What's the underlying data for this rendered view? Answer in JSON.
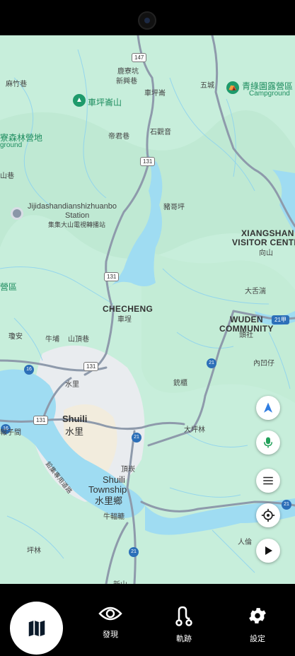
{
  "map": {
    "route_shields": [
      {
        "id": "r147",
        "text": "147"
      },
      {
        "id": "r131a",
        "text": "131"
      },
      {
        "id": "r131b",
        "text": "131"
      },
      {
        "id": "r131c",
        "text": "131"
      },
      {
        "id": "r131d",
        "text": "131"
      },
      {
        "id": "r16a",
        "text": "16"
      },
      {
        "id": "r16b",
        "text": "16"
      },
      {
        "id": "r21a",
        "text": "21"
      },
      {
        "id": "r21b",
        "text": "21"
      },
      {
        "id": "r21c",
        "text": "21"
      },
      {
        "id": "r21d",
        "text": "21"
      },
      {
        "id": "r21e",
        "text": "21甲"
      }
    ],
    "places": {
      "mazhu": "麻竹巷",
      "luliaokeng": "鹿寮坑",
      "xinxingxiang": "新興巷",
      "checheng_shan": "車坪崙山",
      "chepinglun": "車坪崙",
      "wucheng": "五城",
      "dijunxiang": "帝君巷",
      "shiguyin": "石觀音",
      "zhugeping": "豬哥坪",
      "liaosenlin": "寮森林營地",
      "ground": "ground",
      "shanxiang": "山巷",
      "xiangshan_en": "XIANGSHAN",
      "visitor_center_en": "VISITOR CENTER",
      "xiangshan_zh": "向山",
      "ying": "營區",
      "dashewan": "大舌湍",
      "checheng_en": "CHECHENG",
      "checheng_zh": "車埕",
      "wuden_en": "WUDEN",
      "community_en": "COMMUNITY",
      "wuden_zh": "頭社",
      "guian": "瓊安",
      "niuku": "牛埔",
      "shandingxiang": "山頂巷",
      "neiaozi": "內凹仔",
      "shuili_small": "水里",
      "sheng": "銃櫃",
      "shuili_en": "Shuili",
      "shuili_zh": "水里",
      "daping": "大坪林",
      "erzi": "報子間",
      "jishui_road": "鉛集專用道路",
      "dingkan": "頂崁",
      "township_en1": "Shuili",
      "township_en2": "Township",
      "township_zh": "水里鄉",
      "niutianqi": "牛輻轆",
      "renlun": "人倫",
      "pinglin": "坪林",
      "xinshan": "新山"
    },
    "campground": {
      "name": "青綠園露營區",
      "sub": "Campground"
    },
    "station": {
      "line1": "Jijidashandianshizhuanbo",
      "line2": "Station",
      "line3": "集集大山電視轉播站"
    },
    "poi_icon": "mountain-icon"
  },
  "controls": {
    "compass_icon": "navigation-arrow-icon",
    "mic_icon": "microphone-icon",
    "menu_icon": "menu-icon",
    "locate_icon": "crosshair-icon",
    "play_icon": "play-icon",
    "accent_blue": "#2f7de1",
    "accent_green": "#22a15a"
  },
  "nav": {
    "map_icon": "map-icon",
    "items": [
      {
        "label": "發現",
        "icon": "eye-icon"
      },
      {
        "label": "軌跡",
        "icon": "route-icon"
      },
      {
        "label": "設定",
        "icon": "gear-icon"
      }
    ]
  }
}
